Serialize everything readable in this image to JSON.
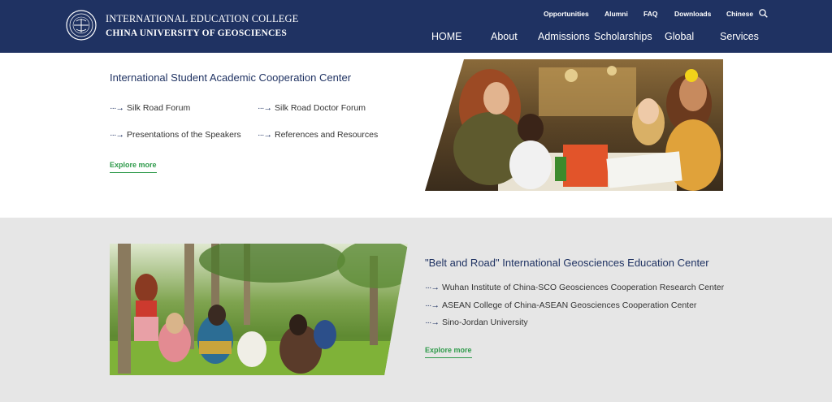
{
  "header": {
    "logo": {
      "line1": "INTERNATIONAL EDUCATION COLLEGE",
      "line2": "CHINA UNIVERSITY OF GEOSCIENCES"
    },
    "utility_links": [
      "Opportunities",
      "Alumni",
      "FAQ",
      "Downloads",
      "Chinese"
    ],
    "search_icon": "search-icon",
    "nav": [
      "HOME",
      "About",
      "Admissions",
      "Scholarships",
      "Global",
      "Services"
    ]
  },
  "center1": {
    "title": "International Student Academic Cooperation Center",
    "links": [
      "Silk Road Forum",
      "Silk Road Doctor Forum",
      "Presentations of the Speakers",
      "References and Resources"
    ],
    "arrow": "···→",
    "explore": "Explore more"
  },
  "center2": {
    "title": "\"Belt and Road\" International Geosciences Education Center",
    "links": [
      "Wuhan Institute of China-SCO Geosciences Cooperation Research Center",
      "ASEAN College of China-ASEAN Geosciences Cooperation Center",
      "Sino-Jordan University"
    ],
    "arrow": "···→",
    "explore": "Explore more"
  },
  "colors": {
    "header_bg": "#1f3262",
    "title": "#1f3262",
    "accent_green": "#2e9a4a",
    "section2_bg": "#e6e6e6"
  }
}
